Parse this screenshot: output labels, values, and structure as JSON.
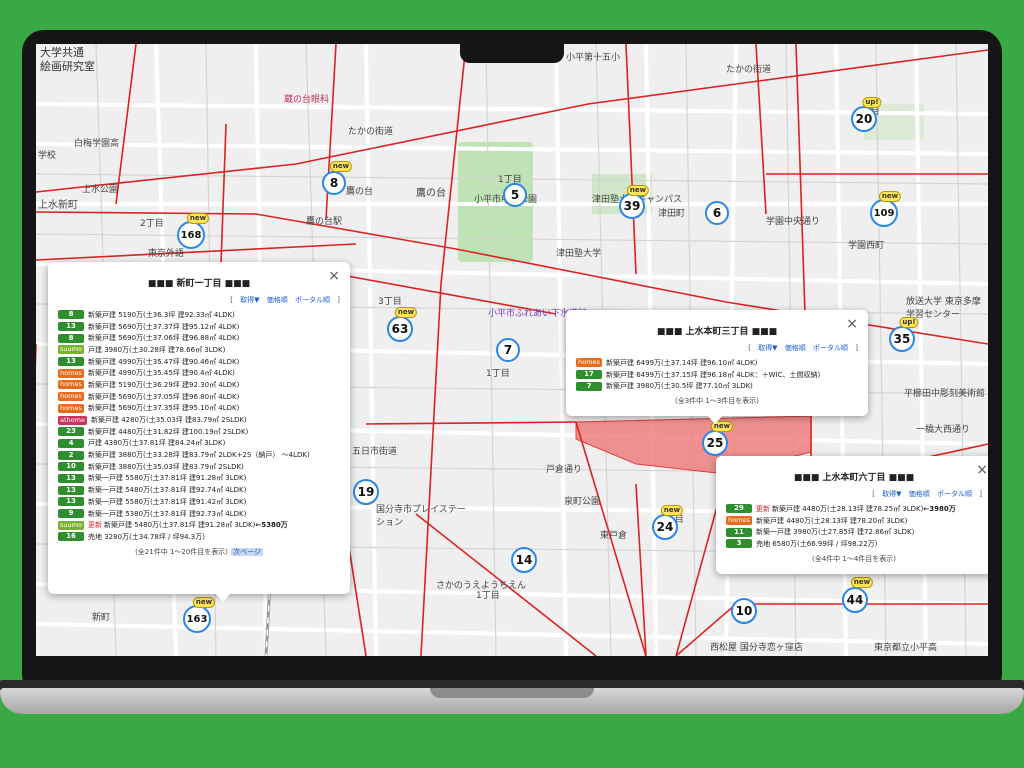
{
  "map": {
    "labels": [
      "大学共通",
      "絵画研究室",
      "白梅学園高",
      "学校",
      "上水公園",
      "上水新町",
      "2丁目",
      "東京外語",
      "鷹の台",
      "鷹の台",
      "たかの街道",
      "たかの街道",
      "小平市中央公園",
      "津田塾大学",
      "津田塾大学キャンパス",
      "津田町",
      "学園中央通り",
      "学園西町",
      "放送大学 東京多摩学習センター",
      "平櫛田中彫刻美術館",
      "一橋大西通り",
      "小平市ふれあい下水道館",
      "3丁目",
      "1丁目",
      "五日市街道",
      "国分寺市プレイステーション",
      "戸倉通り",
      "泉町公園",
      "東戸倉",
      "さかのうえようちえん",
      "新町",
      "西松屋 国分寺恋ヶ窪店",
      "東京都立小平高",
      "1丁目",
      "3丁目",
      "1丁目",
      "4丁目",
      "鷹の台駅",
      "小平第十五小",
      "蔵の台眼科"
    ],
    "markers": [
      {
        "num": "5",
        "tag": ""
      },
      {
        "num": "8",
        "tag": "new"
      },
      {
        "num": "20",
        "tag": "up!"
      },
      {
        "num": "39",
        "tag": "new"
      },
      {
        "num": "6",
        "tag": ""
      },
      {
        "num": "109",
        "tag": "new"
      },
      {
        "num": "168",
        "tag": "new"
      },
      {
        "num": "63",
        "tag": "new"
      },
      {
        "num": "7",
        "tag": ""
      },
      {
        "num": "35",
        "tag": "up!"
      },
      {
        "num": "25",
        "tag": "new"
      },
      {
        "num": "19",
        "tag": ""
      },
      {
        "num": "24",
        "tag": "new"
      },
      {
        "num": "14",
        "tag": ""
      },
      {
        "num": "10",
        "tag": ""
      },
      {
        "num": "44",
        "tag": "new"
      },
      {
        "num": "163",
        "tag": "new"
      }
    ]
  },
  "popup1": {
    "title": "■■■ 新町一丁目 ■■■",
    "close": "×",
    "links": {
      "open": "[",
      "acquire": "取得▼",
      "price": "価格順",
      "portal": "ポータル順",
      "close": "]"
    },
    "rows": [
      {
        "badge": "8",
        "badge_type": "green",
        "text": "新築戸建 5190万(土36.3坪 建92.33㎡ 4LDK)"
      },
      {
        "badge": "13",
        "badge_type": "green",
        "text": "新築戸建 5690万(土37.37坪 建95.12㎡ 4LDK)"
      },
      {
        "badge": "8",
        "badge_type": "green",
        "text": "新築戸建 5690万(土37.06坪 建96.88㎡ 4LDK)"
      },
      {
        "badge": "suumo",
        "badge_type": "suumo",
        "text": "戸建 3980万(土30.28坪 建78.66㎡ 3LDK)"
      },
      {
        "badge": "13",
        "badge_type": "green",
        "text": "新築戸建 4990万(土35.47坪 建90.46㎡ 4LDK)"
      },
      {
        "badge": "homes",
        "badge_type": "homes",
        "text": "新築戸建 4990万(土35.45坪 建90.4㎡ 4LDK)"
      },
      {
        "badge": "homes",
        "badge_type": "homes",
        "text": "新築戸建 5190万(土36.29坪 建92.30㎡ 4LDK)"
      },
      {
        "badge": "homes",
        "badge_type": "homes",
        "text": "新築戸建 5690万(土37.05坪 建96.80㎡ 4LDK)"
      },
      {
        "badge": "homes",
        "badge_type": "homes",
        "text": "新築戸建 5690万(土37.35坪 建95.10㎡ 4LDK)"
      },
      {
        "badge": "athome",
        "badge_type": "athome",
        "text": "新築戸建 4280万(土35.03坪 建83.79㎡ 2SLDK)"
      },
      {
        "badge": "23",
        "badge_type": "green",
        "text": "新築戸建 4480万(土31.82坪 建100.19㎡ 2SLDK)"
      },
      {
        "badge": "4",
        "badge_type": "green",
        "text": "戸建 4380万(土37.81坪 建84.24㎡ 3LDK)"
      },
      {
        "badge": "2",
        "badge_type": "green",
        "text": "新築戸建 3880万(土33.28坪 建83.79㎡ 2LDK+2S（納戸） ～4LDK)"
      },
      {
        "badge": "10",
        "badge_type": "green",
        "text": "新築戸建 3880万(土35.03坪 建83.79㎡ 2SLDK)"
      },
      {
        "badge": "13",
        "badge_type": "green",
        "text": "新築一戸建 5580万(土37.81坪 建91.28㎡ 3LDK)"
      },
      {
        "badge": "13",
        "badge_type": "green",
        "text": "新築一戸建 5480万(土37.81坪 建92.74㎡ 4LDK)"
      },
      {
        "badge": "13",
        "badge_type": "green",
        "text": "新築一戸建 5580万(土37.81坪 建91.42㎡ 3LDK)"
      },
      {
        "badge": "9",
        "badge_type": "green",
        "text": "新築一戸建 5380万(土37.81坪 建92.73㎡ 4LDK)"
      },
      {
        "badge": "suumo",
        "badge_type": "suumo",
        "new": "更新",
        "text": "新築戸建 5480万(土37.81坪 建91.28㎡ 3LDK) ",
        "extra": "←5380万"
      },
      {
        "badge": "16",
        "badge_type": "green",
        "text": "売地 3280万(土34.78坪 / 坪94.3万)"
      }
    ],
    "footer": "(全21件中 1～20件目を表示)",
    "next": "次ページ"
  },
  "popup2": {
    "title": "■■■ 上水本町三丁目 ■■■",
    "close": "×",
    "links": {
      "open": "[",
      "acquire": "取得▼",
      "price": "価格順",
      "portal": "ポータル順",
      "close": "]"
    },
    "rows": [
      {
        "badge": "homes",
        "badge_type": "homes",
        "text": "新築戸建 6499万(土37.14坪 建96.10㎡ 4LDK)"
      },
      {
        "badge": "17",
        "badge_type": "green",
        "text": "新築戸建 6499万(土37.15坪 建96.18㎡ 4LDK：＋WIC、土間収納)"
      },
      {
        "badge": "7",
        "badge_type": "green",
        "text": "新築戸建 3980万(土30.5坪 建77.10㎡ 3LDK)"
      }
    ],
    "footer": "(全3件中 1～3件目を表示)"
  },
  "popup3": {
    "title": "■■■ 上水本町六丁目 ■■■",
    "close": "×",
    "links": {
      "open": "[",
      "acquire": "取得▼",
      "price": "価格順",
      "portal": "ポータル順",
      "close": "]"
    },
    "rows": [
      {
        "badge": "29",
        "badge_type": "green",
        "new": "更新",
        "text": "新築戸建 4480万(土28.13坪 建78.25㎡ 3LDK) ",
        "extra": "←3980万"
      },
      {
        "badge": "homes",
        "badge_type": "homes",
        "text": "新築戸建 4480万(土28.13坪 建78.20㎡ 3LDK)"
      },
      {
        "badge": "11",
        "badge_type": "green",
        "text": "新築一戸建 3980万(土27.85坪 建72.86㎡ 3LDK)"
      },
      {
        "badge": "3",
        "badge_type": "green",
        "text": "売地 6580万(土66.99坪 / 坪98.22万)"
      }
    ],
    "footer": "(全4件中 1～4件目を表示)"
  },
  "colors": {
    "background": "#3aa844",
    "marker_border": "#2b86e8",
    "green_badge": "#2f8f2f",
    "homes": "#e86a1a",
    "suumo": "#7ab32a",
    "athome": "#c8325c",
    "highlight": "#f08080"
  }
}
